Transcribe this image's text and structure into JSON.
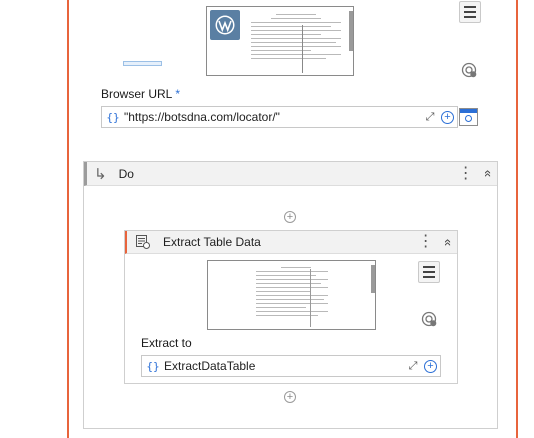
{
  "browser_url": {
    "label": "Browser URL",
    "required_mark": "*",
    "value": "\"https://botsdna.com/locator/\""
  },
  "do_block": {
    "title": "Do"
  },
  "extract_table": {
    "title": "Extract Table Data",
    "extract_to_label": "Extract to",
    "extract_to_value": "ExtractDataTable"
  },
  "icons": {
    "expression": "{}",
    "expand": "⤢",
    "add": "+",
    "more": "⋮",
    "collapse": "«",
    "do_arrow": "↳"
  },
  "colors": {
    "accent_orange": "#e8643c",
    "accent_blue": "#2b6fd6"
  }
}
